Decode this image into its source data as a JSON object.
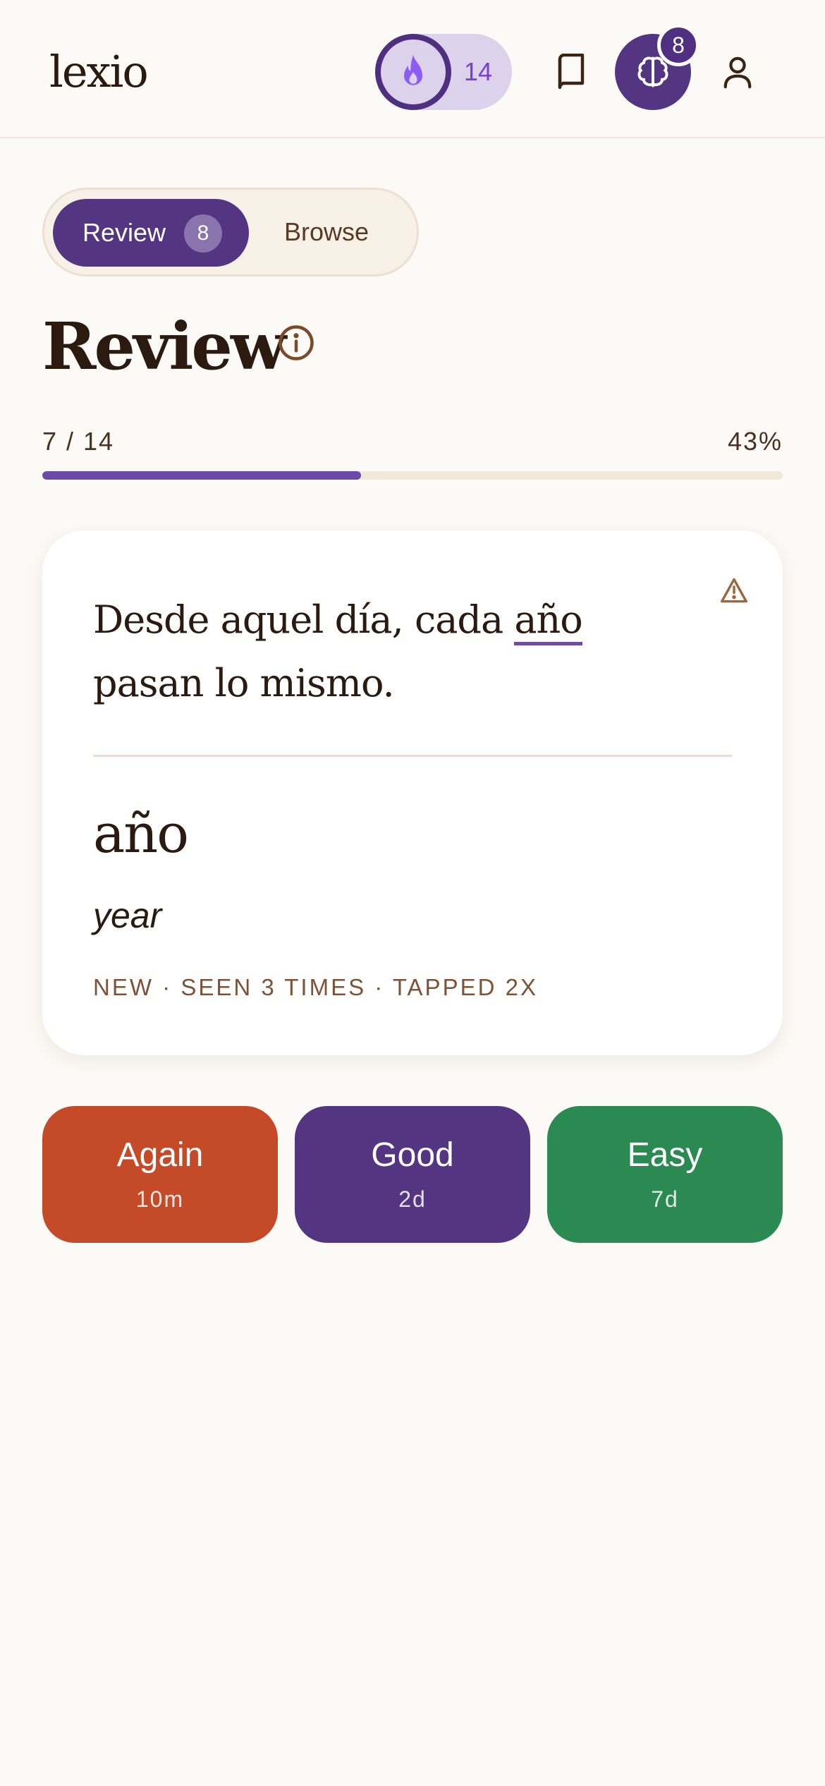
{
  "app": {
    "logo": "lexio"
  },
  "header": {
    "streak_count": "14",
    "streak_icon": "flame-icon",
    "badge_count": "8",
    "icons": [
      "book-icon",
      "brain-icon",
      "user-icon"
    ]
  },
  "tabs": {
    "review_label": "Review",
    "review_count": "8",
    "browse_label": "Browse"
  },
  "page": {
    "title": "Review"
  },
  "progress": {
    "count_label": "7 / 14",
    "percent_label": "43%",
    "fraction": 0.43
  },
  "card": {
    "sentence_before": "Desde aquel día, cada ",
    "sentence_highlight": "año",
    "sentence_after": " pasan lo mismo.",
    "word": "año",
    "translation": "year",
    "meta": "NEW · SEEN 3 TIMES · TAPPED 2X"
  },
  "actions": {
    "again": {
      "label": "Again",
      "interval": "10m"
    },
    "good": {
      "label": "Good",
      "interval": "2d"
    },
    "easy": {
      "label": "Easy",
      "interval": "7d"
    }
  },
  "colors": {
    "accent": "#543582",
    "again": "#c44a28",
    "easy": "#2b8a51",
    "background": "#fcfaf6"
  }
}
